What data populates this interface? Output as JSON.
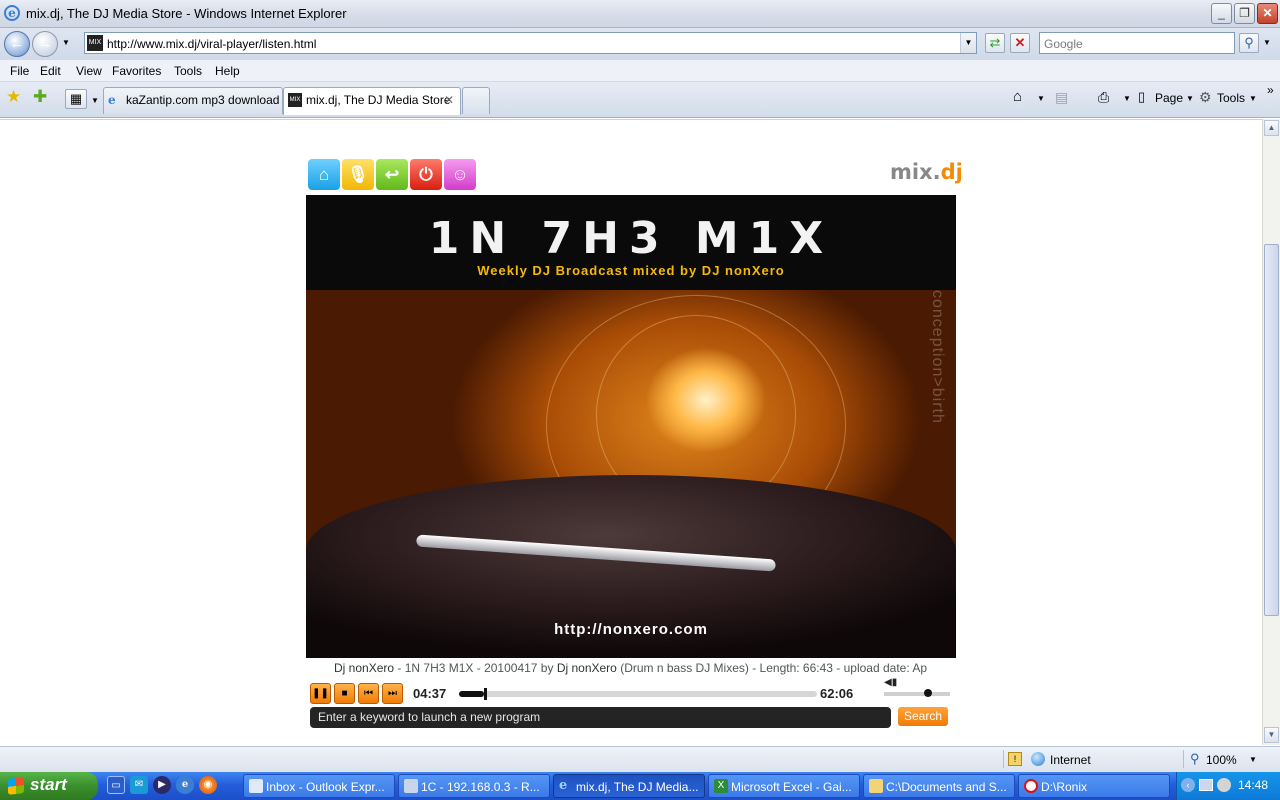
{
  "window": {
    "title": "mix.dj, The DJ Media Store - Windows Internet Explorer",
    "minimize": "_",
    "restore": "❐",
    "close": "✕"
  },
  "address": {
    "url": "http://www.mix.dj/viral-player/listen.html",
    "favicon_text": "MIX",
    "search_placeholder": "Google"
  },
  "menubar": {
    "items": [
      "File",
      "Edit",
      "View",
      "Favorites",
      "Tools",
      "Help"
    ]
  },
  "tabs": [
    {
      "label": "kaZantip.com mp3 download ...",
      "active": false
    },
    {
      "label": "mix.dj, The DJ Media Store",
      "active": true
    }
  ],
  "toolbar": {
    "page_label": "Page",
    "tools_label": "Tools"
  },
  "player": {
    "brand_prefix": "mix.",
    "brand_suffix": "dj",
    "cover_title": "1N 7H3 M1X",
    "cover_subtitle": "Weekly DJ Broadcast mixed by DJ nonXero",
    "cover_side_text": "conception>birth",
    "cover_url": "http://nonxero.com",
    "info": {
      "artist": "Dj nonXero",
      "sep1": " - ",
      "title": "1N 7H3 M1X - 20100417",
      "by": " by ",
      "author": "Dj nonXero",
      "genre": " (Drum n bass DJ Mixes) - Length: ",
      "length": "66:43",
      "upload": " - upload date: Ap"
    },
    "elapsed": "04:37",
    "remaining": "62:06",
    "progress_fraction": 0.069,
    "volume_fraction": 0.6,
    "keyword_placeholder": "Enter a keyword to launch a new program",
    "search_button": "Search"
  },
  "statusbar": {
    "zone": "Internet",
    "zoom": "100%"
  },
  "taskbar": {
    "start": "start",
    "tasks": [
      {
        "label": "Inbox - Outlook Expr...",
        "active": false
      },
      {
        "label": "1C - 192.168.0.3 - R...",
        "active": false
      },
      {
        "label": "mix.dj, The DJ Media...",
        "active": true
      },
      {
        "label": "Microsoft Excel - Gai...",
        "active": false
      },
      {
        "label": "C:\\Documents and S...",
        "active": false
      },
      {
        "label": "D:\\Ronix",
        "active": false
      }
    ],
    "clock": "14:48"
  },
  "colors": {
    "accent_orange": "#f58a07",
    "xp_blue": "#245edb",
    "xp_green": "#3a8f2c"
  }
}
